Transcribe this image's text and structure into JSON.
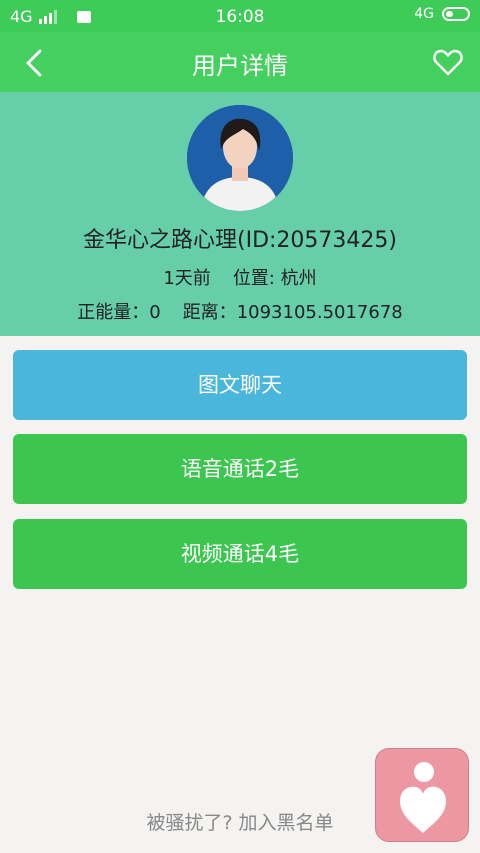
{
  "status_bar": {
    "network_left": "4G",
    "time": "16:08",
    "network_right": "4G"
  },
  "nav": {
    "title": "用户详情",
    "back_icon": "chevron-left-icon",
    "favorite_icon": "heart-outline-icon"
  },
  "profile": {
    "name": "金华心之路心理(ID:20573425)",
    "last_active": "1天前",
    "location_label": "位置:",
    "location": "杭州",
    "energy_label": "正能量：",
    "energy_value": "0",
    "distance_label": "距离：",
    "distance_value": "1093105.5017678"
  },
  "actions": {
    "chat_label": "图文聊天",
    "voice_label": "语音通话2毛",
    "video_label": "视频通话4毛"
  },
  "footer": {
    "blacklist_text": "被骚扰了? 加入黑名单"
  },
  "colors": {
    "nav_green": "#45cf5e",
    "profile_teal": "#67ceaa",
    "chat_blue": "#4ab6db",
    "call_green": "#3cc650",
    "float_pink": "#ec97a1"
  }
}
